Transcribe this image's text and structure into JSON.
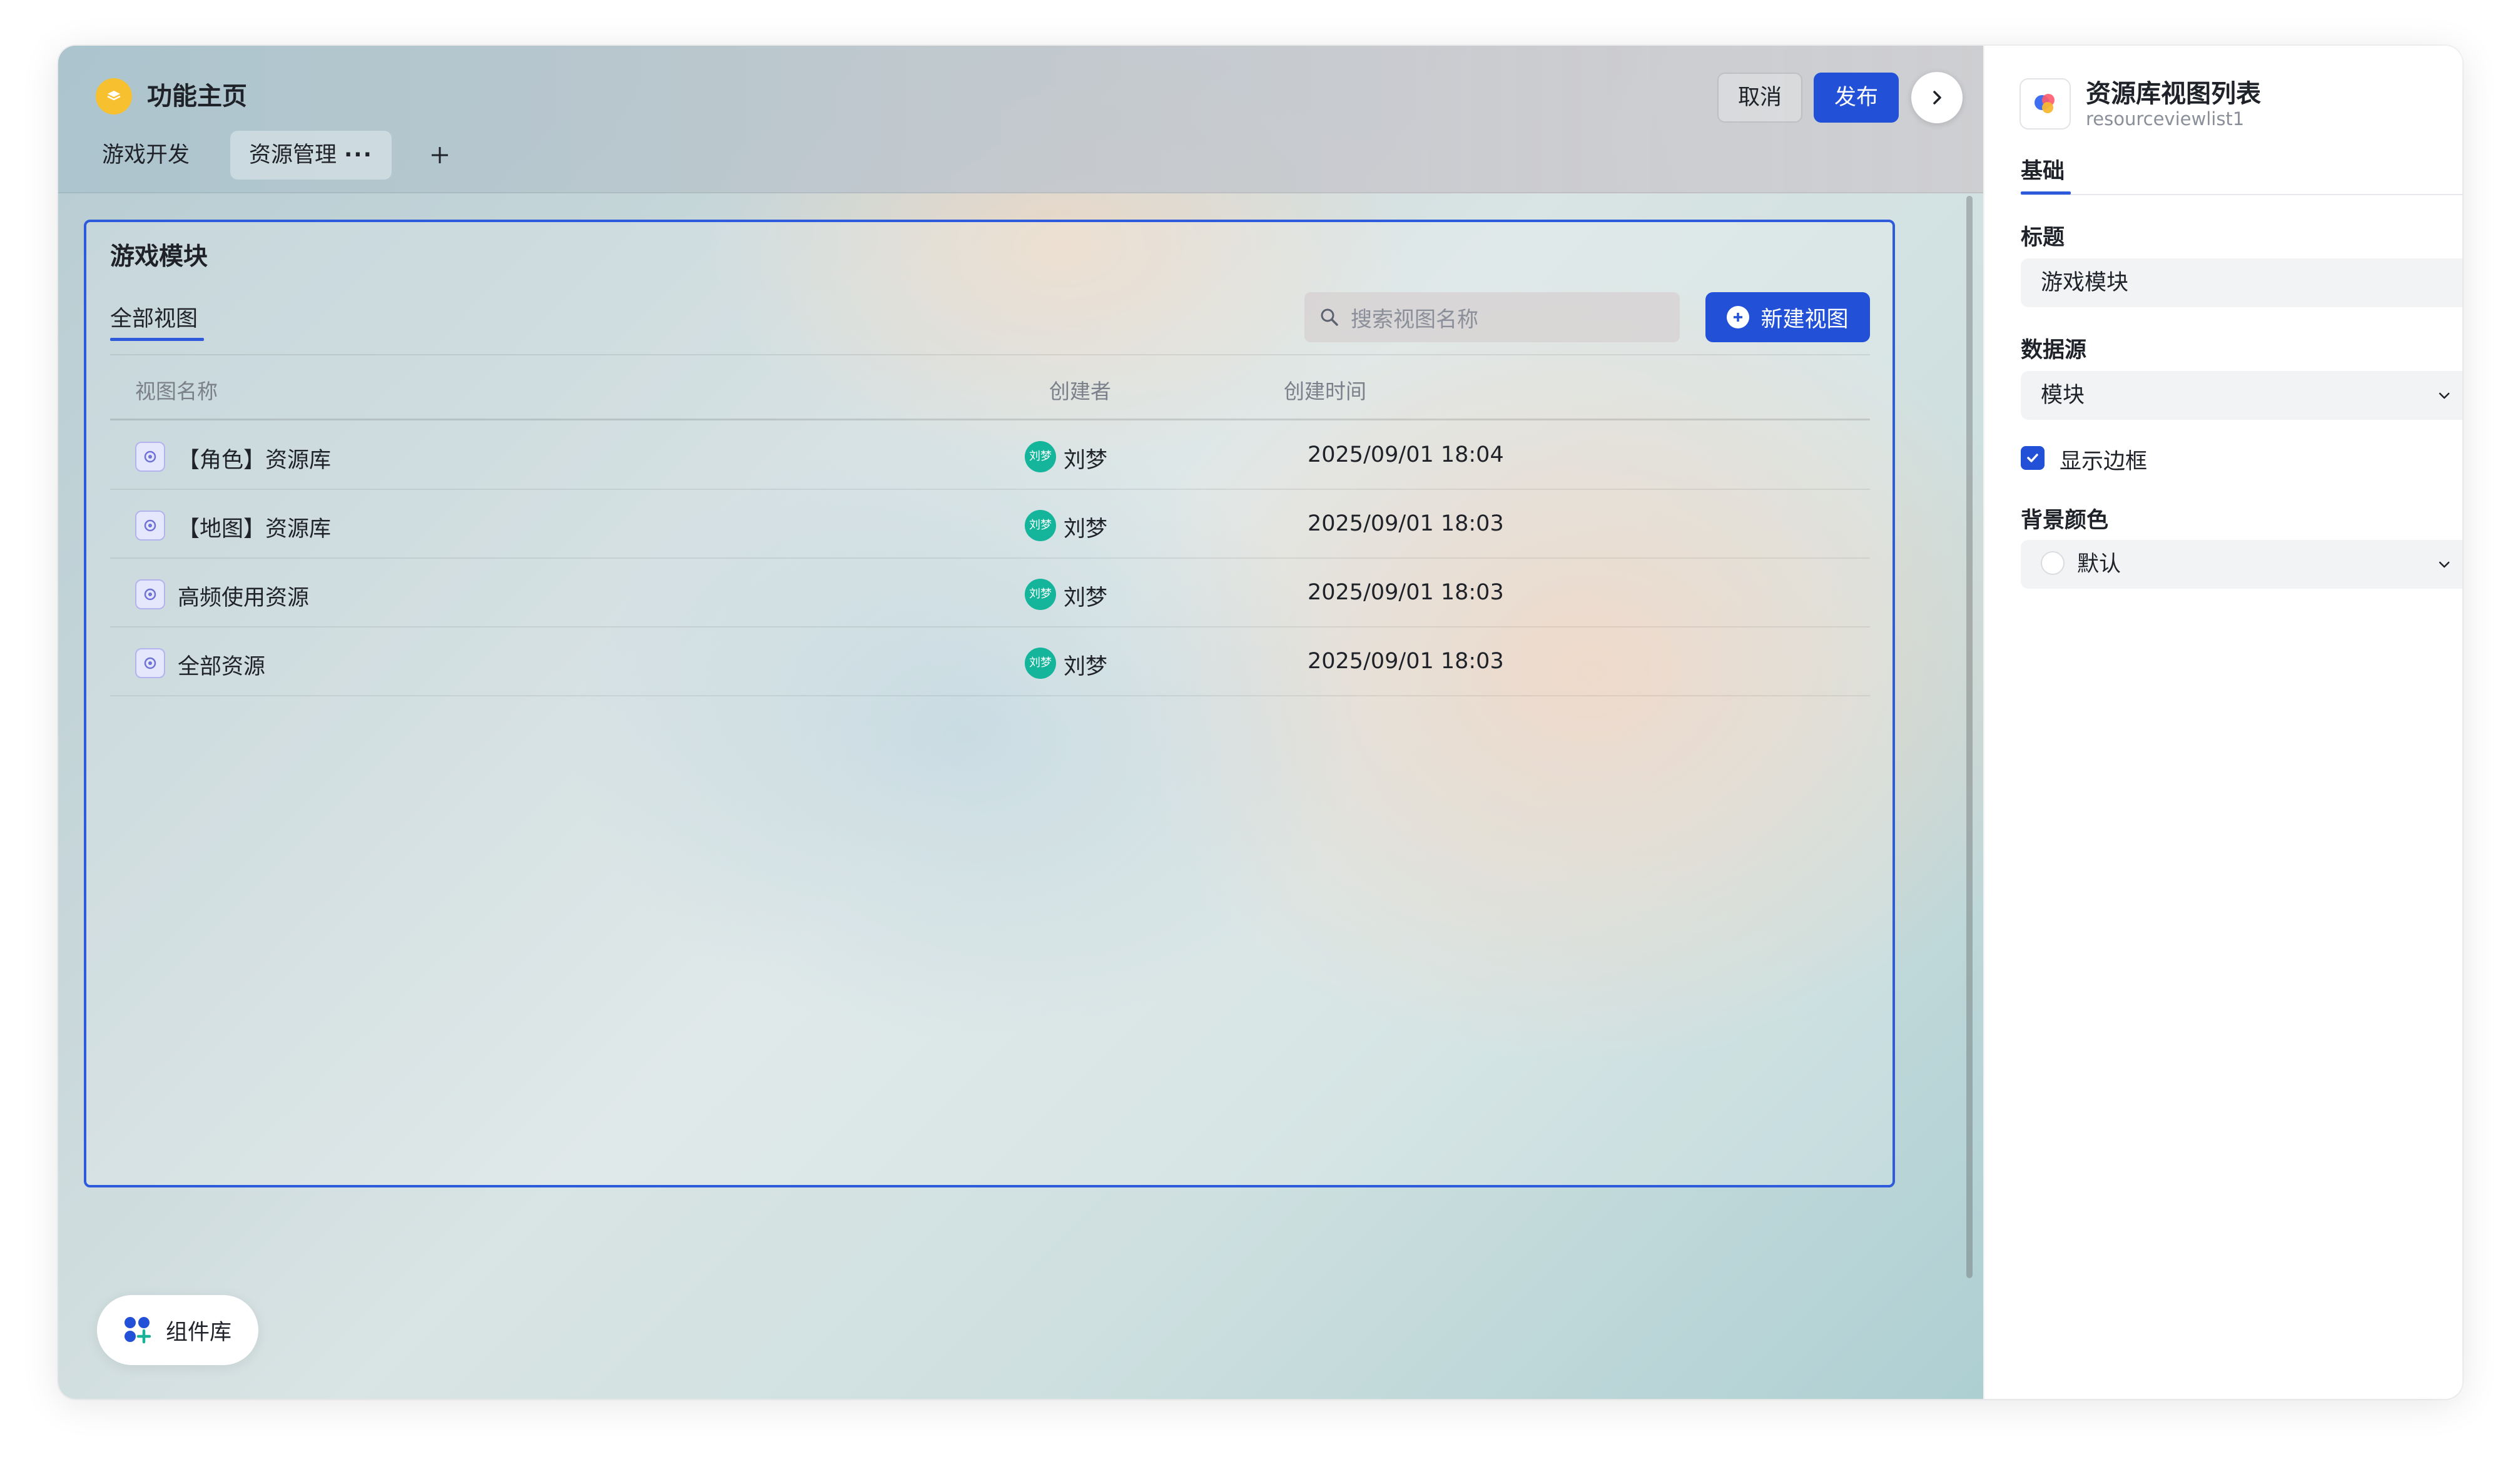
{
  "app": {
    "title": "功能主页",
    "tabs": [
      {
        "label": "游戏开发"
      },
      {
        "label": "资源管理",
        "more": "···"
      }
    ],
    "cancel_label": "取消",
    "publish_label": "发布"
  },
  "module": {
    "title": "游戏模块",
    "view_tab": "全部视图",
    "search_placeholder": "搜索视图名称",
    "new_view_label": "新建视图",
    "columns": [
      "视图名称",
      "创建者",
      "创建时间"
    ],
    "rows": [
      {
        "name": "【角色】资源库",
        "avatar": "刘梦",
        "creator": "刘梦",
        "time": "2025/09/01 18:04"
      },
      {
        "name": "【地图】资源库",
        "avatar": "刘梦",
        "creator": "刘梦",
        "time": "2025/09/01 18:03"
      },
      {
        "name": "高频使用资源",
        "avatar": "刘梦",
        "creator": "刘梦",
        "time": "2025/09/01 18:03"
      },
      {
        "name": "全部资源",
        "avatar": "刘梦",
        "creator": "刘梦",
        "time": "2025/09/01 18:03"
      }
    ]
  },
  "component_library": {
    "label": "组件库"
  },
  "panel": {
    "title": "资源库视图列表",
    "subtitle": "resourceviewlist1",
    "tab": "基础",
    "title_label": "标题",
    "title_value": "游戏模块",
    "datasource_label": "数据源",
    "datasource_value": "模块",
    "show_border_label": "显示边框",
    "show_border_checked": true,
    "bg_label": "背景颜色",
    "bg_value": "默认"
  },
  "colors": {
    "accent": "#2251d8",
    "avatar": "#15b59b",
    "app_icon": "#f7c02f"
  },
  "icons": [
    "layers-icon",
    "dots-icon",
    "plus-icon",
    "chevron-right-icon",
    "search-icon",
    "plus-circle-icon",
    "resource-view-icon",
    "component-library-icon",
    "chevron-down-icon",
    "check-icon",
    "resource-list-app-icon"
  ]
}
